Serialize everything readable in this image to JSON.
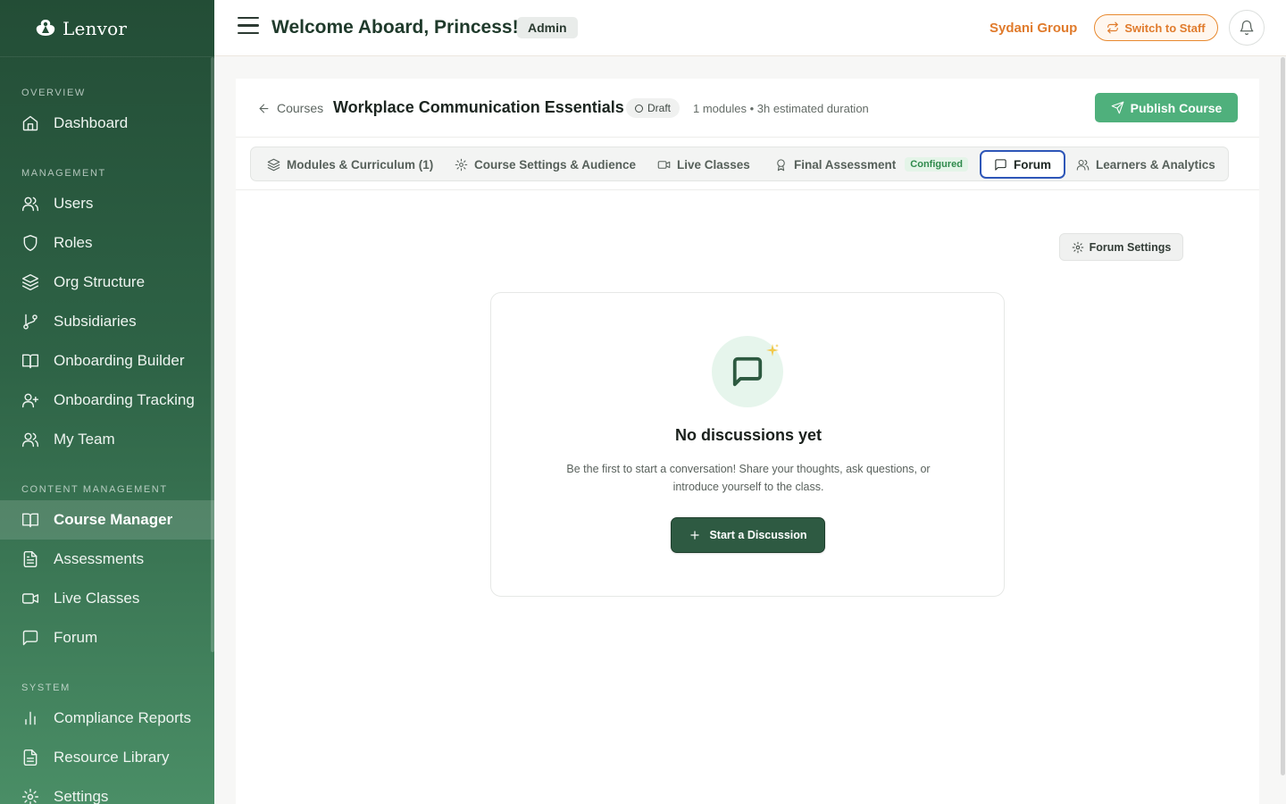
{
  "brand": {
    "name": "Lenvor"
  },
  "header": {
    "welcome": "Welcome Aboard, Princess!",
    "role": "Admin",
    "org": "Sydani Group",
    "switch_label": "Switch to Staff"
  },
  "sidebar": {
    "sections": {
      "overview": "OVERVIEW",
      "management": "MANAGEMENT",
      "content": "CONTENT MANAGEMENT",
      "system": "SYSTEM"
    },
    "items": [
      {
        "label": "Dashboard",
        "icon": "home-icon"
      },
      {
        "label": "Users",
        "icon": "users-icon"
      },
      {
        "label": "Roles",
        "icon": "shield-icon"
      },
      {
        "label": "Org Structure",
        "icon": "layers-icon"
      },
      {
        "label": "Subsidiaries",
        "icon": "git-branch-icon"
      },
      {
        "label": "Onboarding Builder",
        "icon": "book-icon"
      },
      {
        "label": "Onboarding Tracking",
        "icon": "user-plus-icon"
      },
      {
        "label": "My Team",
        "icon": "users-icon"
      },
      {
        "label": "Course Manager",
        "icon": "book-open-icon",
        "active": true
      },
      {
        "label": "Assessments",
        "icon": "file-text-icon"
      },
      {
        "label": "Live Classes",
        "icon": "video-icon"
      },
      {
        "label": "Forum",
        "icon": "message-square-icon"
      },
      {
        "label": "Compliance Reports",
        "icon": "bar-chart-icon"
      },
      {
        "label": "Resource Library",
        "icon": "file-icon"
      },
      {
        "label": "Settings",
        "icon": "gear-icon"
      }
    ]
  },
  "course": {
    "back_label": "Courses",
    "title": "Workplace Communication Essentials",
    "status": "Draft",
    "meta": "1 modules • 3h estimated duration",
    "publish_label": "Publish Course"
  },
  "tabs": [
    {
      "label": "Modules & Curriculum (1)",
      "icon": "layers-icon"
    },
    {
      "label": "Course Settings & Audience",
      "icon": "gear-icon"
    },
    {
      "label": "Live Classes",
      "icon": "video-icon"
    },
    {
      "label": "Final Assessment",
      "icon": "award-icon",
      "badge": "Configured"
    },
    {
      "label": "Forum",
      "icon": "message-square-icon",
      "active": true
    },
    {
      "label": "Learners & Analytics",
      "icon": "users-icon"
    }
  ],
  "forum": {
    "settings_label": "Forum Settings",
    "empty_title": "No discussions yet",
    "empty_desc": "Be the first to start a conversation! Share your thoughts, ask questions, or introduce yourself to the class.",
    "start_label": "Start a Discussion"
  },
  "colors": {
    "sidebar_top": "#234d36",
    "sidebar_bottom": "#4a8e66",
    "accent_orange": "#e07b2c",
    "publish_green": "#4fb07c",
    "primary_dark_green": "#2e5a42",
    "active_tab_border": "#2e56b8"
  }
}
